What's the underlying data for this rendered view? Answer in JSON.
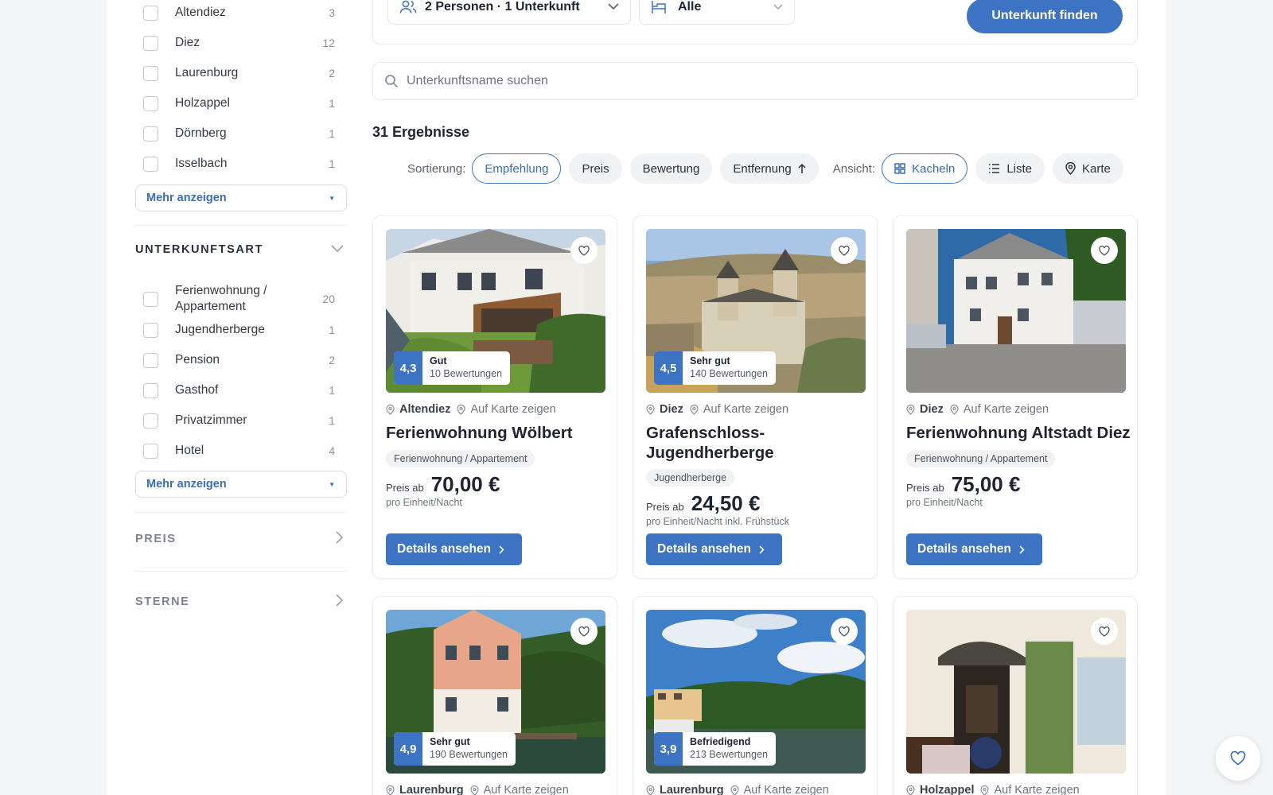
{
  "sidebar": {
    "towns": [
      {
        "label": "Altendiez",
        "count": "3"
      },
      {
        "label": "Diez",
        "count": "12"
      },
      {
        "label": "Laurenburg",
        "count": "2"
      },
      {
        "label": "Holzappel",
        "count": "1"
      },
      {
        "label": "Dörnberg",
        "count": "1"
      },
      {
        "label": "Isselbach",
        "count": "1"
      }
    ],
    "more_label": "Mehr anzeigen",
    "type_section": {
      "title": "UNTERKUNFTSART",
      "items": [
        {
          "label": "Ferienwohnung / Appartement",
          "count": "20"
        },
        {
          "label": "Jugendherberge",
          "count": "1"
        },
        {
          "label": "Pension",
          "count": "2"
        },
        {
          "label": "Gasthof",
          "count": "1"
        },
        {
          "label": "Privatzimmer",
          "count": "1"
        },
        {
          "label": "Hotel",
          "count": "4"
        }
      ]
    },
    "price_section": "PREIS",
    "stars_section": "STERNE"
  },
  "topbar": {
    "guests": "2 Personen · 1 Unterkunft",
    "bed_filter": "Alle",
    "find_button": "Unterkunft finden"
  },
  "search": {
    "placeholder": "Unterkunftsname suchen"
  },
  "results_count": "31 Ergebnisse",
  "sort": {
    "label": "Sortierung:",
    "options": [
      "Empfehlung",
      "Preis",
      "Bewertung",
      "Entfernung"
    ],
    "active": "Empfehlung"
  },
  "view": {
    "label": "Ansicht:",
    "options": [
      "Kacheln",
      "Liste",
      "Karte"
    ],
    "active": "Kacheln"
  },
  "colors": {
    "accent": "#3c73c2"
  },
  "cards": [
    {
      "score": "4,3",
      "rating_label": "Gut",
      "reviews": "10 Bewertungen",
      "town": "Altendiez",
      "map_link": "Auf Karte zeigen",
      "title": "Ferienwohnung Wölbert",
      "type": "Ferienwohnung / Appartement",
      "price_from": "Preis ab",
      "price": "70,00 €",
      "unit": "pro Einheit/Nacht",
      "button": "Details ansehen"
    },
    {
      "score": "4,5",
      "rating_label": "Sehr gut",
      "reviews": "140 Bewertungen",
      "town": "Diez",
      "map_link": "Auf Karte zeigen",
      "title": "Grafenschloss-Jugendherberge",
      "type": "Jugendherberge",
      "price_from": "Preis ab",
      "price": "24,50 €",
      "unit": "pro Einheit/Nacht inkl. Frühstück",
      "button": "Details ansehen"
    },
    {
      "town": "Diez",
      "map_link": "Auf Karte zeigen",
      "title": "Ferienwohnung Altstadt Diez",
      "type": "Ferienwohnung / Appartement",
      "price_from": "Preis ab",
      "price": "75,00 €",
      "unit": "pro Einheit/Nacht",
      "button": "Details ansehen"
    },
    {
      "score": "4,9",
      "rating_label": "Sehr gut",
      "reviews": "190 Bewertungen",
      "town": "Laurenburg",
      "map_link": "Auf Karte zeigen"
    },
    {
      "score": "3,9",
      "rating_label": "Befriedigend",
      "reviews": "213 Bewertungen",
      "town": "Laurenburg",
      "map_link": "Auf Karte zeigen"
    },
    {
      "town": "Holzappel",
      "map_link": "Auf Karte zeigen"
    }
  ]
}
